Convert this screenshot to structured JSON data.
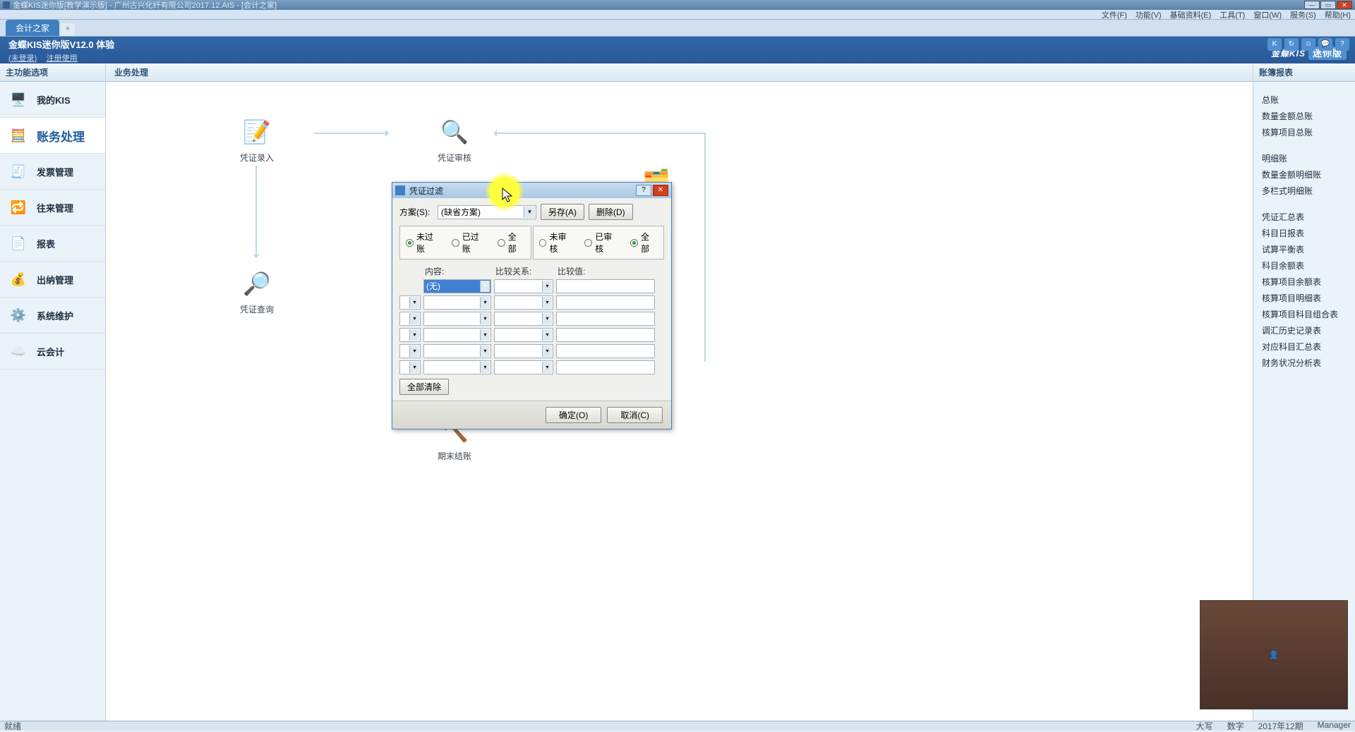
{
  "title_bar": {
    "text": "金蝶KIS迷你版[教学演示版] - 广州古兴化纤有限公司2017.12.AIS - [会计之家]"
  },
  "menu": {
    "items": [
      "文件(F)",
      "功能(V)",
      "基础资料(E)",
      "工具(T)",
      "窗口(W)",
      "服务(S)",
      "帮助(H)"
    ]
  },
  "tabs": {
    "active": "会计之家"
  },
  "header": {
    "product": "金蝶KIS迷你版V12.0 体验",
    "link_login": "(未登录)",
    "link_register": "注册使用",
    "brand": "金蝶KIS",
    "brand_mini": "迷你版"
  },
  "sidebar": {
    "title": "主功能选项",
    "items": [
      {
        "label": "我的KIS"
      },
      {
        "label": "账务处理"
      },
      {
        "label": "发票管理"
      },
      {
        "label": "往来管理"
      },
      {
        "label": "报表"
      },
      {
        "label": "出纳管理"
      },
      {
        "label": "系统维护"
      },
      {
        "label": "云会计"
      }
    ]
  },
  "content": {
    "title": "业务处理",
    "nodes": {
      "entry": "凭证录入",
      "audit": "凭证审核",
      "query": "凭证查询",
      "closing": "期末结账"
    }
  },
  "right_panel": {
    "title": "账簿报表",
    "groups": [
      [
        "总账",
        "数量金额总账",
        "核算项目总账"
      ],
      [
        "明细账",
        "数量金额明细账",
        "多栏式明细账"
      ],
      [
        "凭证汇总表",
        "科目日报表",
        "试算平衡表",
        "科目余额表",
        "核算项目余额表",
        "核算项目明细表",
        "核算项目科目组合表",
        "调汇历史记录表",
        "对应科目汇总表",
        "财务状况分析表"
      ]
    ]
  },
  "dialog": {
    "title": "凭证过滤",
    "scheme_label": "方案(S):",
    "scheme_value": "(缺省方案)",
    "btn_saveas": "另存(A)",
    "btn_delete": "删除(D)",
    "radios1": [
      "未过账",
      "已过账",
      "全部"
    ],
    "radios2": [
      "未审核",
      "已审核",
      "全部"
    ],
    "col_content": "内容:",
    "col_relation": "比较关系:",
    "col_value": "比较值:",
    "first_sel": "(无)",
    "btn_clearall": "全部清除",
    "btn_ok": "确定(O)",
    "btn_cancel": "取消(C)"
  },
  "status": {
    "left": "就绪",
    "r1": "大写",
    "r2": "数字",
    "r3": "2017年12期",
    "r4": "Manager"
  }
}
